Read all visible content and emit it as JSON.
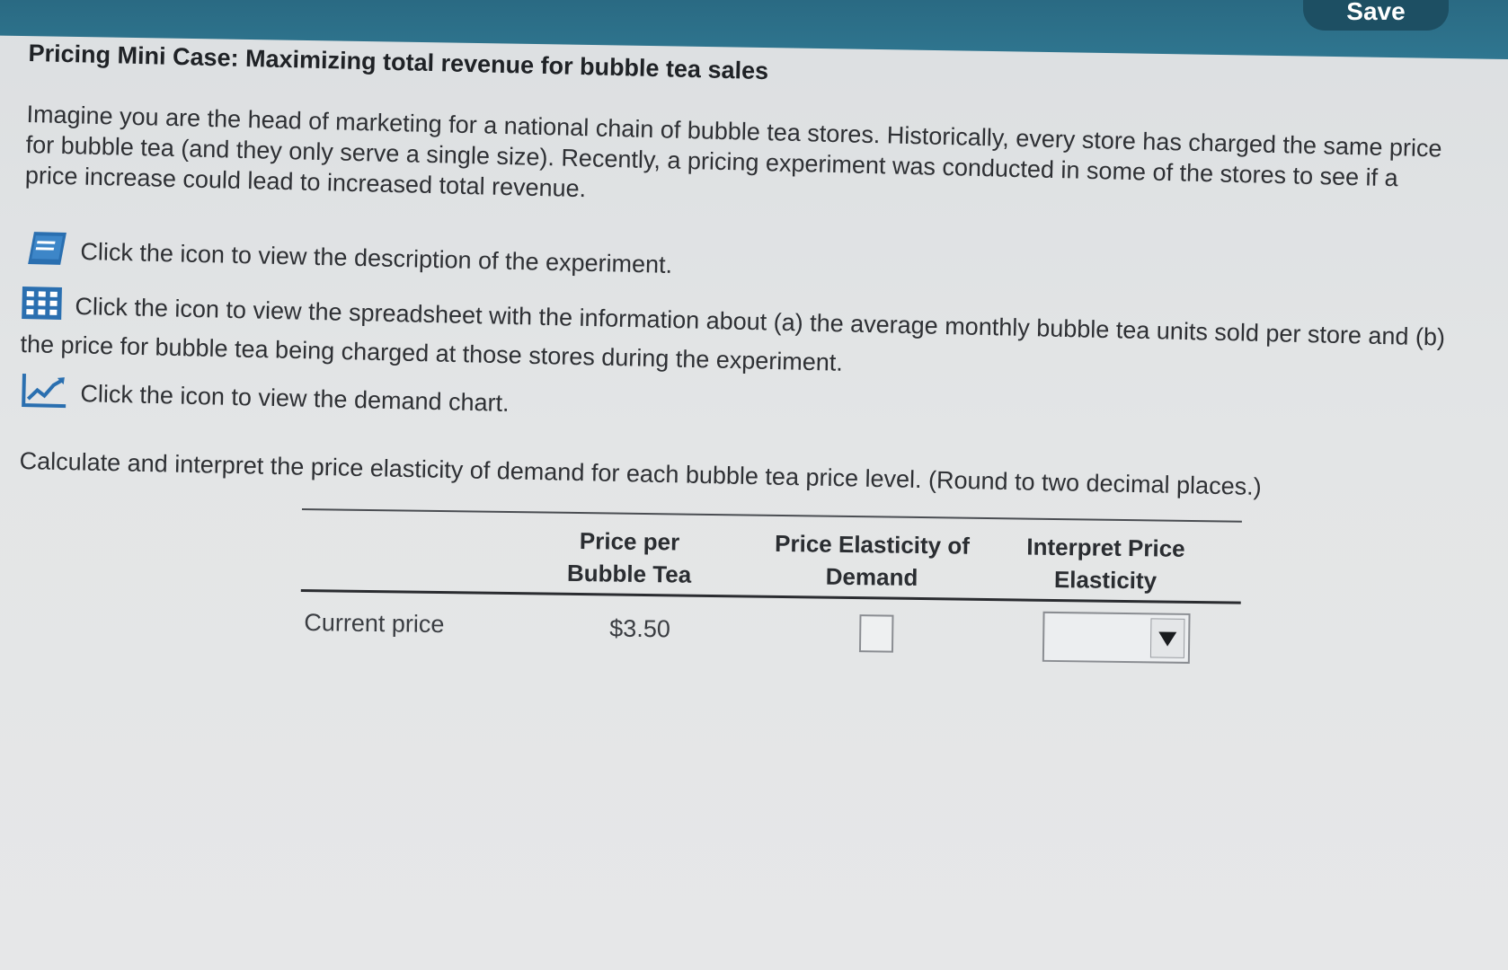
{
  "header": {
    "save_label": "Save"
  },
  "title": "Pricing Mini Case: Maximizing total revenue for bubble tea sales",
  "intro": "Imagine you are the head of marketing for a national chain of bubble tea stores. Historically, every store has charged the same price for bubble tea (and they only serve a single size). Recently, a pricing experiment was conducted in some of the stores to see if a price increase could lead to increased total revenue.",
  "links": [
    {
      "icon": "book-icon",
      "text": "Click the icon to view the description of the experiment."
    },
    {
      "icon": "spreadsheet-icon",
      "text": "Click the icon to view the spreadsheet with the information about (a) the average monthly bubble tea units sold per store and (b) the price for bubble tea being charged at those stores during the experiment."
    },
    {
      "icon": "chart-icon",
      "text": "Click the icon to view the demand chart."
    }
  ],
  "instructions": "Calculate and interpret the price elasticity of demand for each bubble tea price level. (Round to two decimal places.)",
  "table": {
    "headers": {
      "price": "Price per Bubble Tea",
      "elasticity": "Price Elasticity of Demand",
      "interpret": "Interpret Price Elasticity"
    },
    "rows": [
      {
        "label": "Current price",
        "price": "$3.50",
        "elasticity": "",
        "interpret": ""
      }
    ]
  },
  "colors": {
    "header_bar": "#2f7690",
    "save_button": "#1d4f63",
    "icon_blue": "#2a6fb0",
    "background": "#e3e5e6"
  }
}
